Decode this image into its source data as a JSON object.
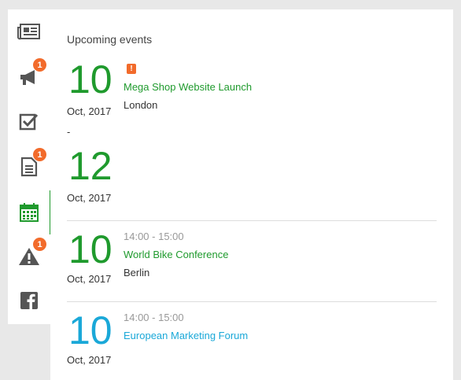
{
  "sidebar": {
    "items": [
      {
        "name": "news",
        "badge": ""
      },
      {
        "name": "announcements",
        "badge": "1"
      },
      {
        "name": "tasks",
        "badge": ""
      },
      {
        "name": "documents",
        "badge": "1"
      },
      {
        "name": "calendar",
        "badge": ""
      },
      {
        "name": "alerts",
        "badge": "1"
      },
      {
        "name": "facebook",
        "badge": ""
      }
    ]
  },
  "panel": {
    "title": "Upcoming events",
    "events": [
      {
        "start_day": "10",
        "start_month": "Oct, 2017",
        "range_sep": "-",
        "end_day": "12",
        "end_month": "Oct, 2017",
        "title": "Mega Shop Website Launch",
        "location": "London",
        "flag": "!"
      },
      {
        "start_day": "10",
        "start_month": "Oct, 2017",
        "time": "14:00 - 15:00",
        "title": "World Bike Conference",
        "location": "Berlin"
      },
      {
        "start_day": "10",
        "start_month": "Oct, 2017",
        "time": "14:00 - 15:00",
        "title": "European Marketing Forum"
      }
    ]
  },
  "colors": {
    "green": "#1f9a2d",
    "blue": "#1aa8d8",
    "badge": "#f26b2b"
  }
}
